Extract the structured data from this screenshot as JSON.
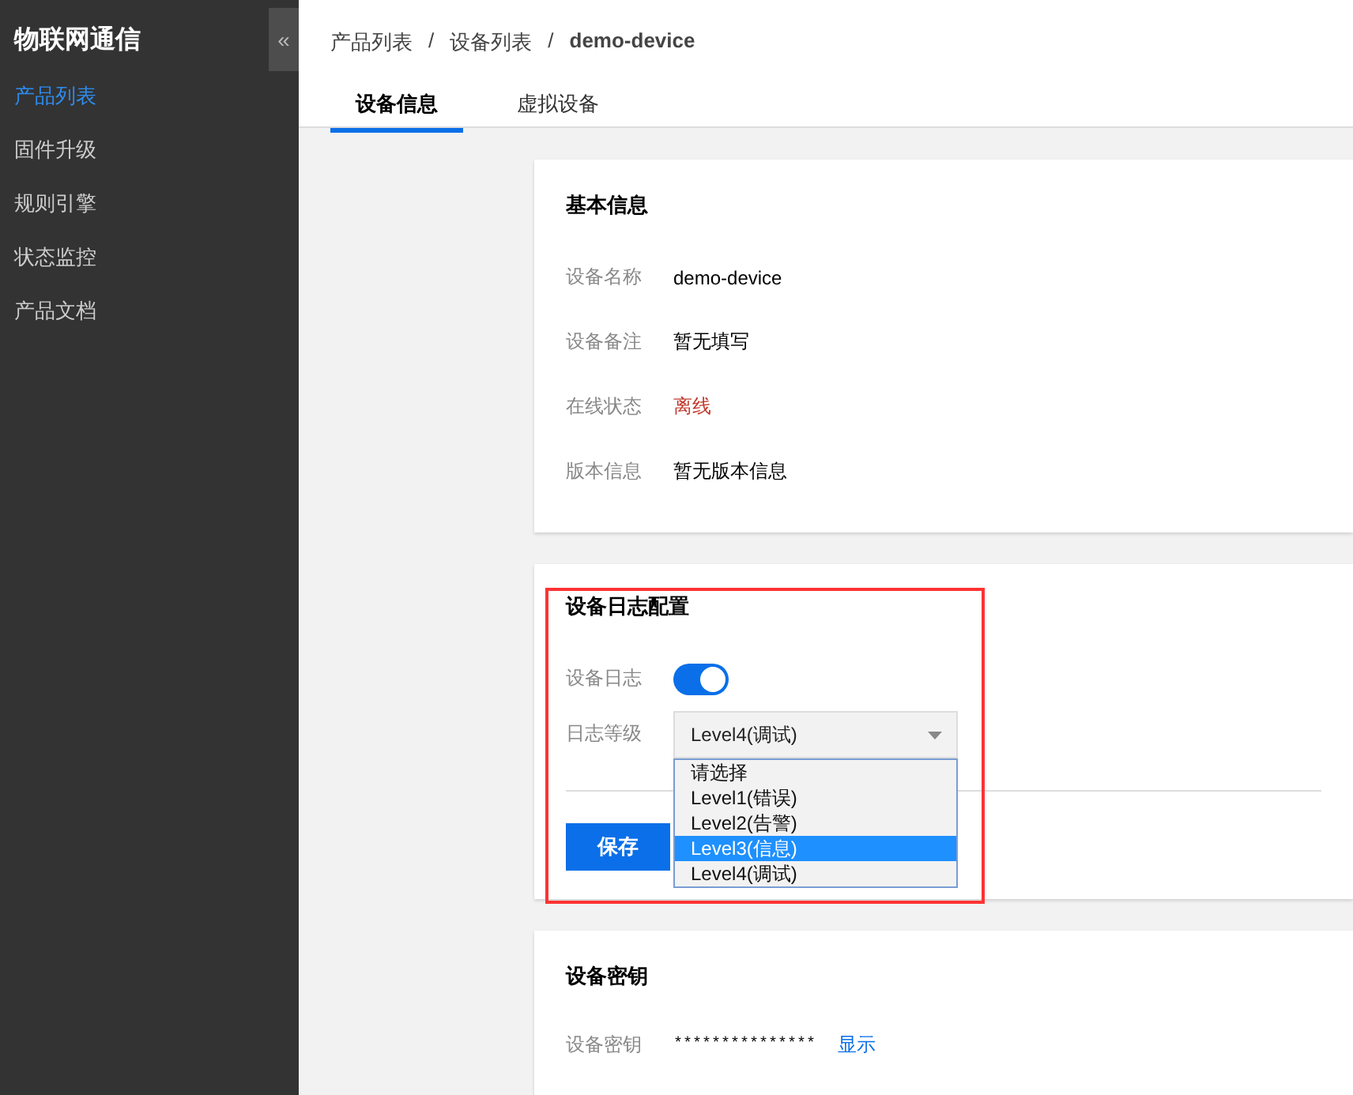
{
  "sidebar": {
    "title": "物联网通信",
    "collapse_glyph": "«",
    "items": [
      {
        "label": "产品列表",
        "selected": true
      },
      {
        "label": "固件升级",
        "selected": false
      },
      {
        "label": "规则引擎",
        "selected": false
      },
      {
        "label": "状态监控",
        "selected": false
      },
      {
        "label": "产品文档",
        "selected": false
      }
    ]
  },
  "breadcrumb": [
    "产品列表",
    "设备列表",
    "demo-device"
  ],
  "breadcrumb_separator": "/",
  "tabs": [
    {
      "label": "设备信息",
      "selected": true
    },
    {
      "label": "虚拟设备",
      "selected": false
    }
  ],
  "basic_info": {
    "title": "基本信息",
    "rows": [
      {
        "label": "设备名称",
        "value": "demo-device",
        "kind": "normal"
      },
      {
        "label": "设备备注",
        "value": "暂无填写",
        "kind": "normal"
      },
      {
        "label": "在线状态",
        "value": "离线",
        "kind": "offline"
      },
      {
        "label": "版本信息",
        "value": "暂无版本信息",
        "kind": "normal"
      }
    ]
  },
  "log_config": {
    "title": "设备日志配置",
    "log_label": "设备日志",
    "log_on": true,
    "level_label": "日志等级",
    "level_value": "Level4(调试)",
    "dropdown_open": true,
    "options": [
      {
        "label": "请选择",
        "selected": false
      },
      {
        "label": "Level1(错误)",
        "selected": false
      },
      {
        "label": "Level2(告警)",
        "selected": false
      },
      {
        "label": "Level3(信息)",
        "selected": true
      },
      {
        "label": "Level4(调试)",
        "selected": false
      }
    ],
    "save_button": "保存",
    "highlighted": true
  },
  "key_card": {
    "title": "设备密钥",
    "label": "设备密钥",
    "value": "***************",
    "show_link": "显示"
  }
}
